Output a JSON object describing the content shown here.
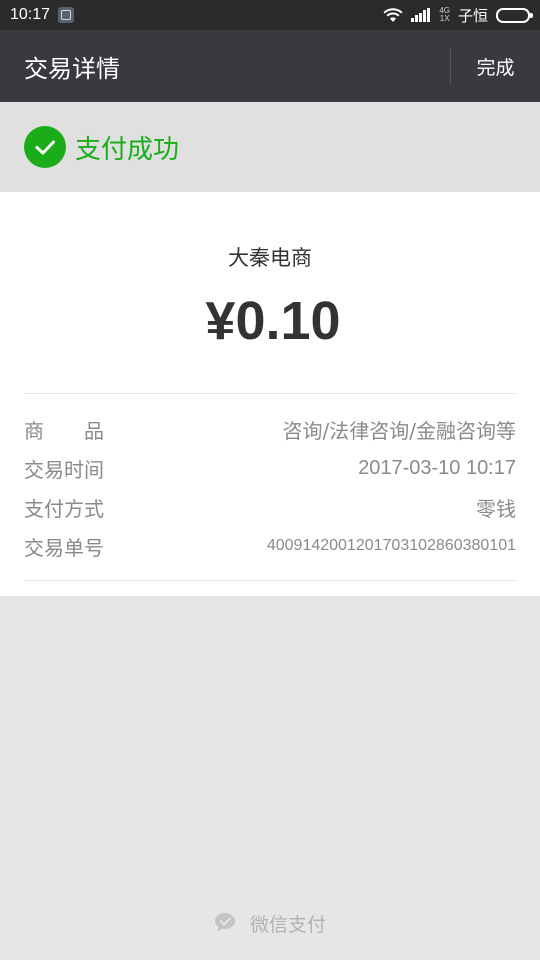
{
  "status_bar": {
    "time": "10:17",
    "network_top": "4G",
    "network_bottom": "1X",
    "carrier": "子恒"
  },
  "nav": {
    "title": "交易详情",
    "done_label": "完成"
  },
  "status": {
    "text": "支付成功",
    "color": "#1aad19"
  },
  "transaction": {
    "merchant": "大秦电商",
    "amount": "¥0.10",
    "details": [
      {
        "label": "商品",
        "value": "咨询/法律咨询/金融咨询等"
      },
      {
        "label": "交易时间",
        "value": "2017-03-10 10:17"
      },
      {
        "label": "支付方式",
        "value": "零钱"
      },
      {
        "label": "交易单号",
        "value": "4009142001201703102860380101"
      }
    ]
  },
  "footer": {
    "label": "微信支付"
  },
  "icons": [
    "app-notification-icon",
    "wifi-icon",
    "signal-icon",
    "battery-icon",
    "check-icon",
    "wechat-pay-icon"
  ]
}
